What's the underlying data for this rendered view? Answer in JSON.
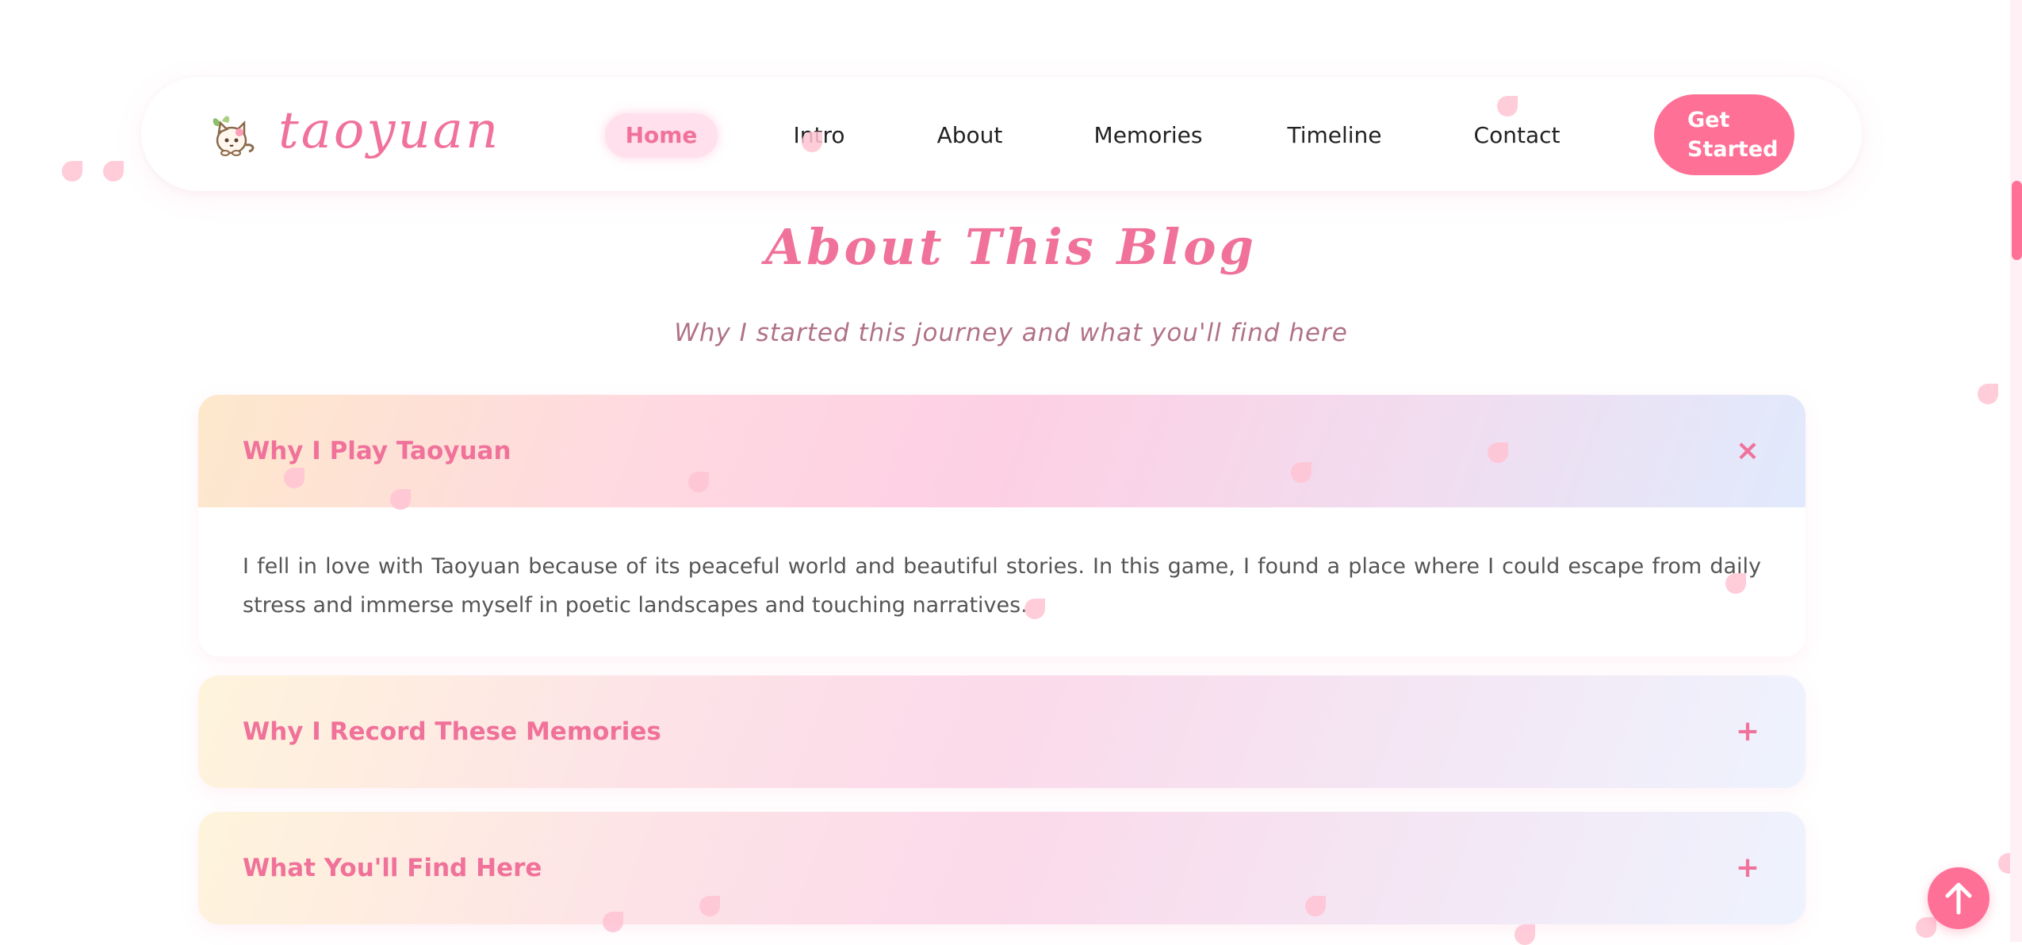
{
  "brand": {
    "name": "taoyuan",
    "logo_icon": "cat-with-leaf-icon"
  },
  "nav": {
    "items": [
      {
        "label": "Home",
        "active": true
      },
      {
        "label": "Intro",
        "active": false
      },
      {
        "label": "About",
        "active": false
      },
      {
        "label": "Memories",
        "active": false
      },
      {
        "label": "Timeline",
        "active": false
      },
      {
        "label": "Contact",
        "active": false
      }
    ],
    "cta_label": "Get Started"
  },
  "about": {
    "title": "About This Blog",
    "subtitle": "Why I started this journey and what you'll find here",
    "accordion": [
      {
        "title": "Why I Play Taoyuan",
        "expanded": true,
        "toggle_icon": "close-icon",
        "toggle_glyph": "×",
        "body": "I fell in love with Taoyuan because of its peaceful world and beautiful stories. In this game, I found a place where I could escape from daily stress and immerse myself in poetic landscapes and touching narratives."
      },
      {
        "title": "Why I Record These Memories",
        "expanded": false,
        "toggle_icon": "plus-icon",
        "toggle_glyph": "+"
      },
      {
        "title": "What You'll Find Here",
        "expanded": false,
        "toggle_icon": "plus-icon",
        "toggle_glyph": "+"
      }
    ]
  },
  "back_to_top_icon": "arrow-up-icon",
  "colors": {
    "accent": "#f0729a",
    "button": "#ff7096",
    "nav_active_bg": "#ffe0ec",
    "petal": "#ffc3d4",
    "subtitle": "#b07286"
  }
}
